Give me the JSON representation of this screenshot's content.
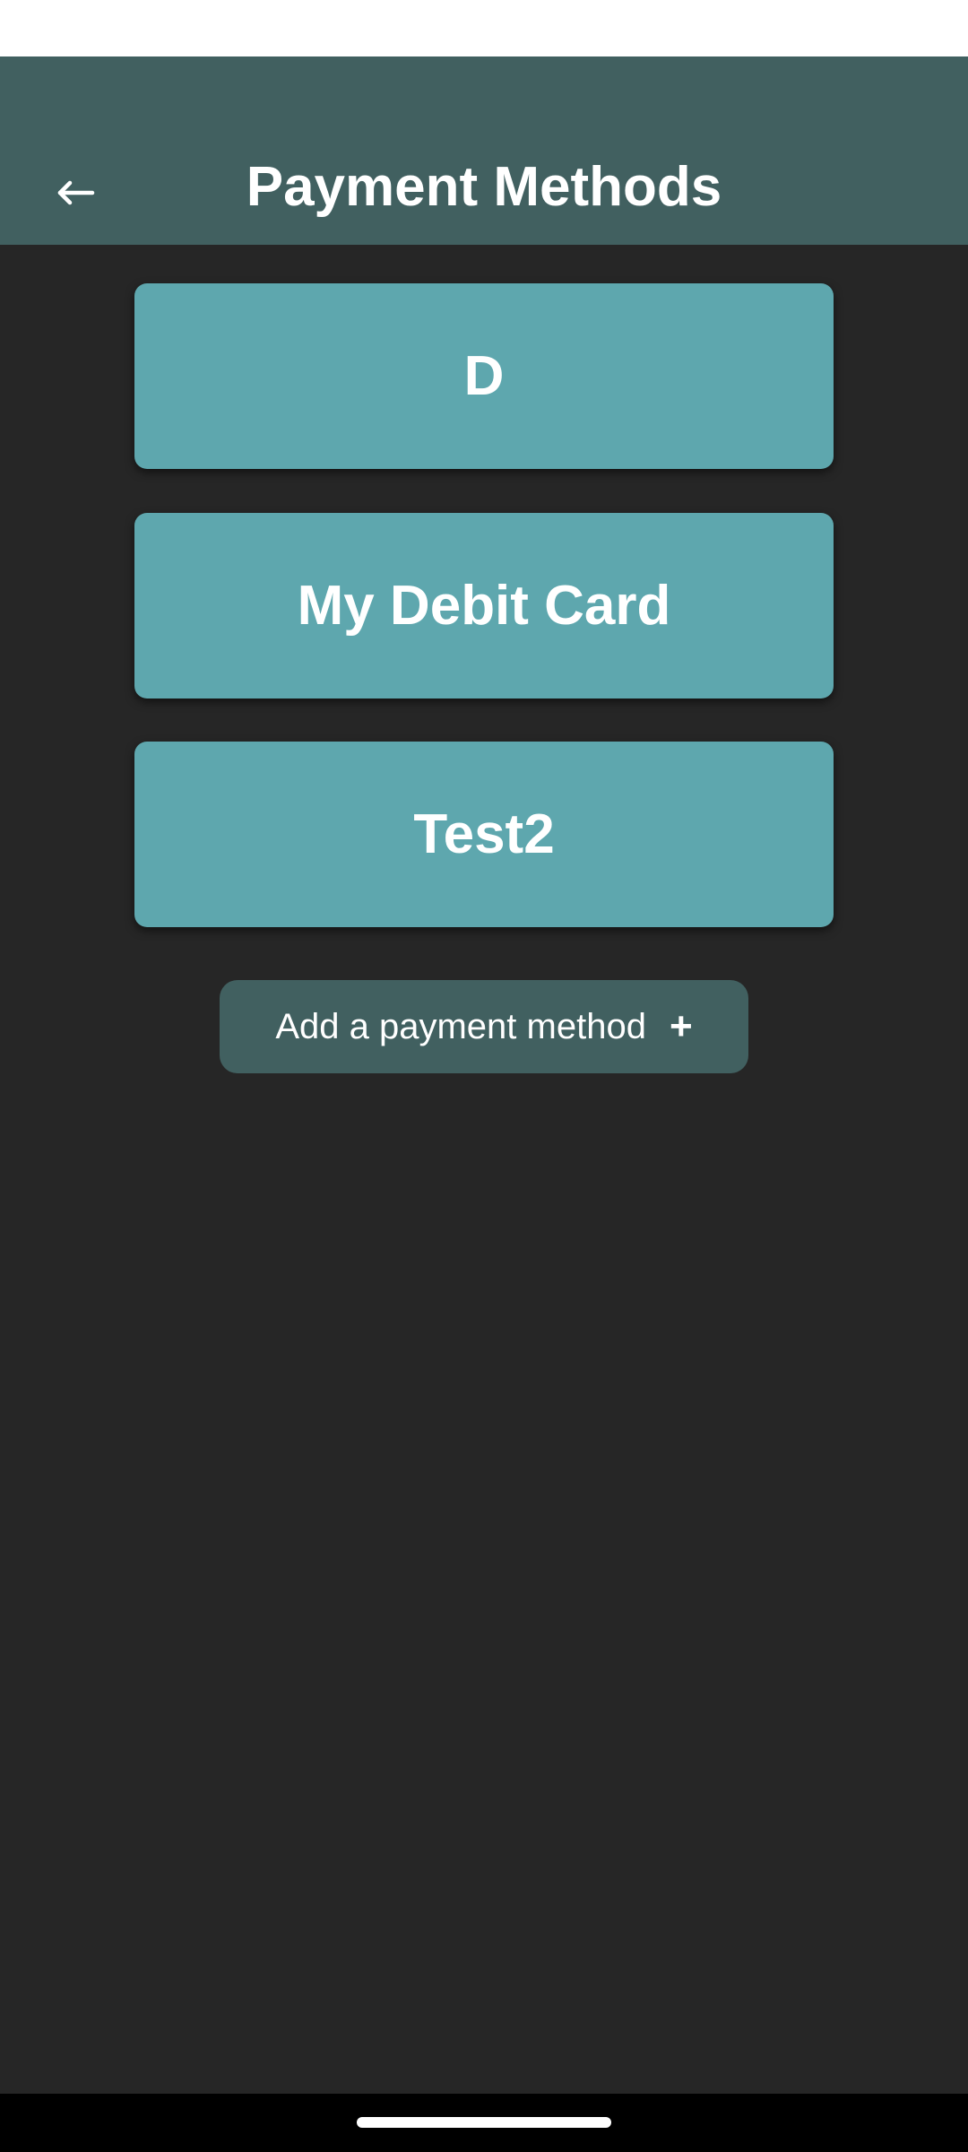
{
  "header": {
    "title": "Payment Methods",
    "back_icon": "arrow-left-icon"
  },
  "payment_methods": [
    {
      "label": "D"
    },
    {
      "label": "My Debit Card"
    },
    {
      "label": "Test2"
    }
  ],
  "add_button": {
    "label": "Add a payment method",
    "icon": "+"
  },
  "colors": {
    "app_bar": "#416060",
    "background": "#262626",
    "card": "#5ea7ae",
    "text": "#ffffff"
  }
}
